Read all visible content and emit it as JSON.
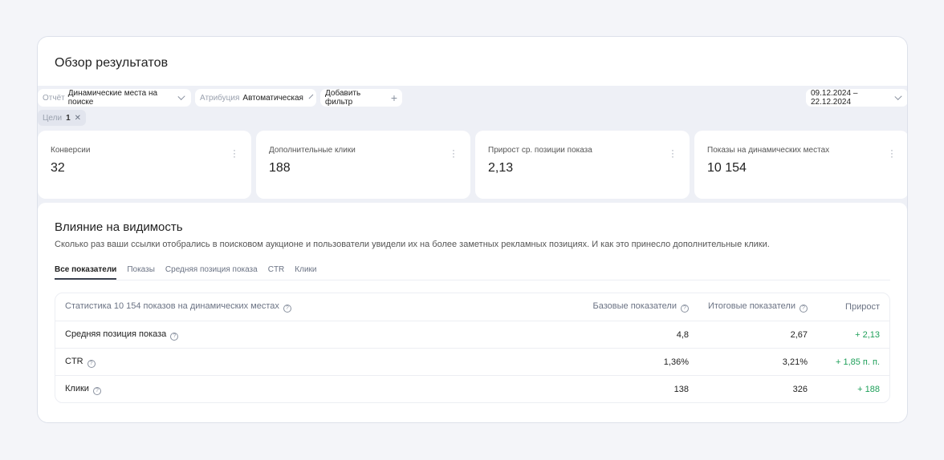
{
  "header": {
    "title": "Обзор результатов"
  },
  "filters": {
    "report_label": "Отчёт",
    "report_value": "Динамические места на поиске",
    "attribution_label": "Атрибуция",
    "attribution_value": "Автоматическая",
    "add_filter": "Добавить фильтр",
    "add_icon": "+",
    "date_range": "09.12.2024 – 22.12.2024",
    "goals_label": "Цели",
    "goals_count": "1",
    "close_icon": "✕"
  },
  "cards": [
    {
      "label": "Конверсии",
      "value": "32"
    },
    {
      "label": "Дополнительные клики",
      "value": "188"
    },
    {
      "label": "Прирост ср. позиции показа",
      "value": "2,13"
    },
    {
      "label": "Показы на динамических местах",
      "value": "10 154"
    }
  ],
  "section": {
    "title": "Влияние на видимость",
    "description": "Сколько раз ваши ссылки отобрались в поисковом аукционе и пользователи увидели их на более заметных рекламных позициях. И как это принесло дополнительные клики."
  },
  "tabs": [
    "Все показатели",
    "Показы",
    "Средняя позиция показа",
    "CTR",
    "Клики"
  ],
  "table": {
    "headers": [
      "Статистика 10 154 показов на динамических местах",
      "Базовые показатели",
      "Итоговые показатели",
      "Прирост"
    ],
    "rows": [
      [
        "Средняя позиция показа",
        "4,8",
        "2,67",
        "+ 2,13"
      ],
      [
        "CTR",
        "1,36%",
        "3,21%",
        "+ 1,85 п. п."
      ],
      [
        "Клики",
        "138",
        "326",
        "+ 188"
      ]
    ]
  },
  "help_icon": "?"
}
